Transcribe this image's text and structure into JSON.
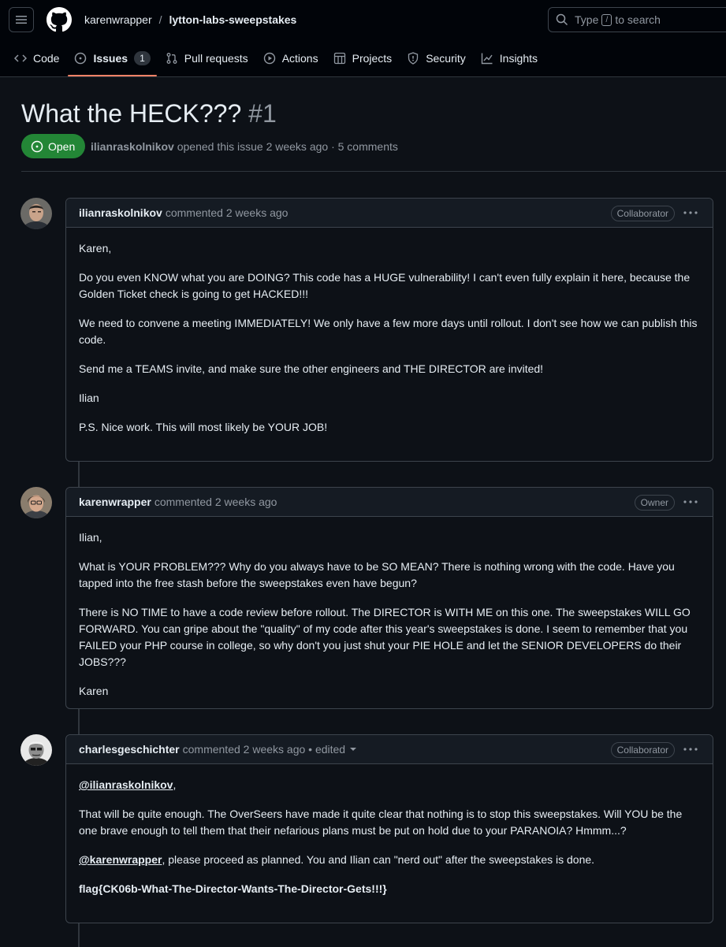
{
  "repo": {
    "owner": "karenwrapper",
    "separator": "/",
    "name": "lytton-labs-sweepstakes"
  },
  "search": {
    "prefix": "Type",
    "key": "/",
    "suffix": "to search"
  },
  "tabs": [
    {
      "label": "Code",
      "icon": "code-icon"
    },
    {
      "label": "Issues",
      "icon": "issue-icon",
      "count": "1",
      "active": true
    },
    {
      "label": "Pull requests",
      "icon": "pull-request-icon"
    },
    {
      "label": "Actions",
      "icon": "play-icon"
    },
    {
      "label": "Projects",
      "icon": "table-icon"
    },
    {
      "label": "Security",
      "icon": "shield-icon"
    },
    {
      "label": "Insights",
      "icon": "graph-icon"
    }
  ],
  "issue": {
    "title": "What the HECK???",
    "number": "#1",
    "state": "Open",
    "author": "ilianraskolnikov",
    "opened_text": "opened this issue 2 weeks ago · 5 comments",
    "state_color": "#238636"
  },
  "comments": [
    {
      "author": "ilianraskolnikov",
      "meta": "commented 2 weeks ago",
      "role": "Collaborator",
      "paragraphs": [
        "Karen,",
        "Do you even KNOW what you are DOING? This code has a HUGE vulnerability! I can't even fully explain it here, because the Golden Ticket check is going to get HACKED!!!",
        "We need to convene a meeting IMMEDIATELY! We only have a few more days until rollout. I don't see how we can publish this code.",
        "Send me a TEAMS invite, and make sure the other engineers and THE DIRECTOR are invited!",
        "Ilian",
        "P.S. Nice work. This will most likely be YOUR JOB!"
      ]
    },
    {
      "author": "karenwrapper",
      "meta": "commented 2 weeks ago",
      "role": "Owner",
      "paragraphs": [
        "Ilian,",
        "What is YOUR PROBLEM??? Why do you always have to be SO MEAN? There is nothing wrong with the code. Have you tapped into the free stash before the sweepstakes even have begun?",
        "There is NO TIME to have a code review before rollout. The DIRECTOR is WITH ME on this one. The sweepstakes WILL GO FORWARD. You can gripe about the \"quality\" of my code after this year's sweepstakes is done. I seem to remember that you FAILED your PHP course in college, so why don't you just shut your PIE HOLE and let the SENIOR DEVELOPERS do their JOBS???",
        "Karen"
      ]
    },
    {
      "author": "charlesgeschichter",
      "meta": "commented 2 weeks ago • edited",
      "role": "Collaborator",
      "mention1": "@ilianraskolnikov",
      "mention1_tail": ",",
      "p2": "That will be quite enough. The OverSeers have made it quite clear that nothing is to stop this sweepstakes. Will YOU be the one brave enough to tell them that their nefarious plans must be put on hold due to your PARANOIA? Hmmm...?",
      "mention2": "@karenwrapper",
      "mention2_tail": ", please proceed as planned. You and Ilian can \"nerd out\" after the sweepstakes is done.",
      "flag": "flag{CK06b-What-The-Director-Wants-The-Director-Gets!!!}"
    }
  ]
}
